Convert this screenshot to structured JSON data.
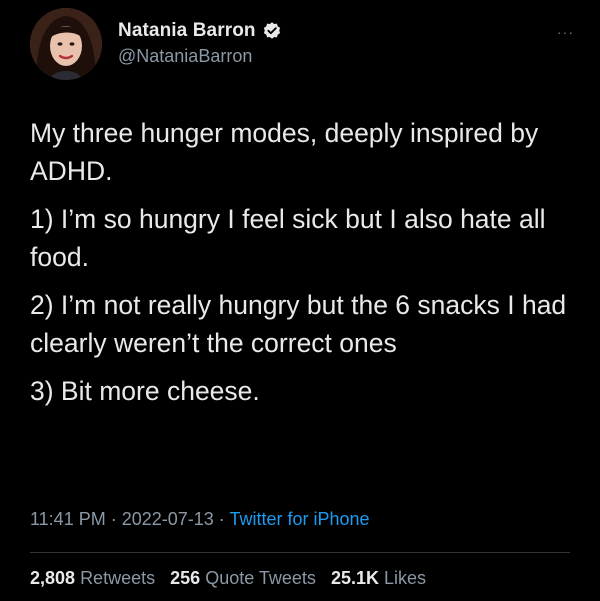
{
  "author": {
    "display_name": "Natania Barron",
    "handle": "@NataniaBarron",
    "verified_icon": "verified-badge-icon",
    "avatar_icon": "avatar-photo"
  },
  "more_menu": "···",
  "tweet": {
    "paragraphs": [
      "My three hunger modes, deeply inspired by ADHD.",
      "1) I’m so hungry I feel sick but I also hate all food.",
      "2) I’m not really hungry but the 6 snacks I had clearly weren’t the correct ones",
      "3) Bit more cheese."
    ]
  },
  "meta": {
    "time": "11:41 PM",
    "separator": " · ",
    "date": "2022-07-13",
    "source": "Twitter for iPhone"
  },
  "stats": {
    "retweets_count": "2,808",
    "retweets_label": "Retweets",
    "quote_count": "256",
    "quote_label": "Quote Tweets",
    "likes_count": "25.1K",
    "likes_label": "Likes"
  },
  "colors": {
    "background": "#000000",
    "text": "#e7e9ea",
    "secondary": "#8b98a5",
    "accent": "#1d9bf0"
  }
}
